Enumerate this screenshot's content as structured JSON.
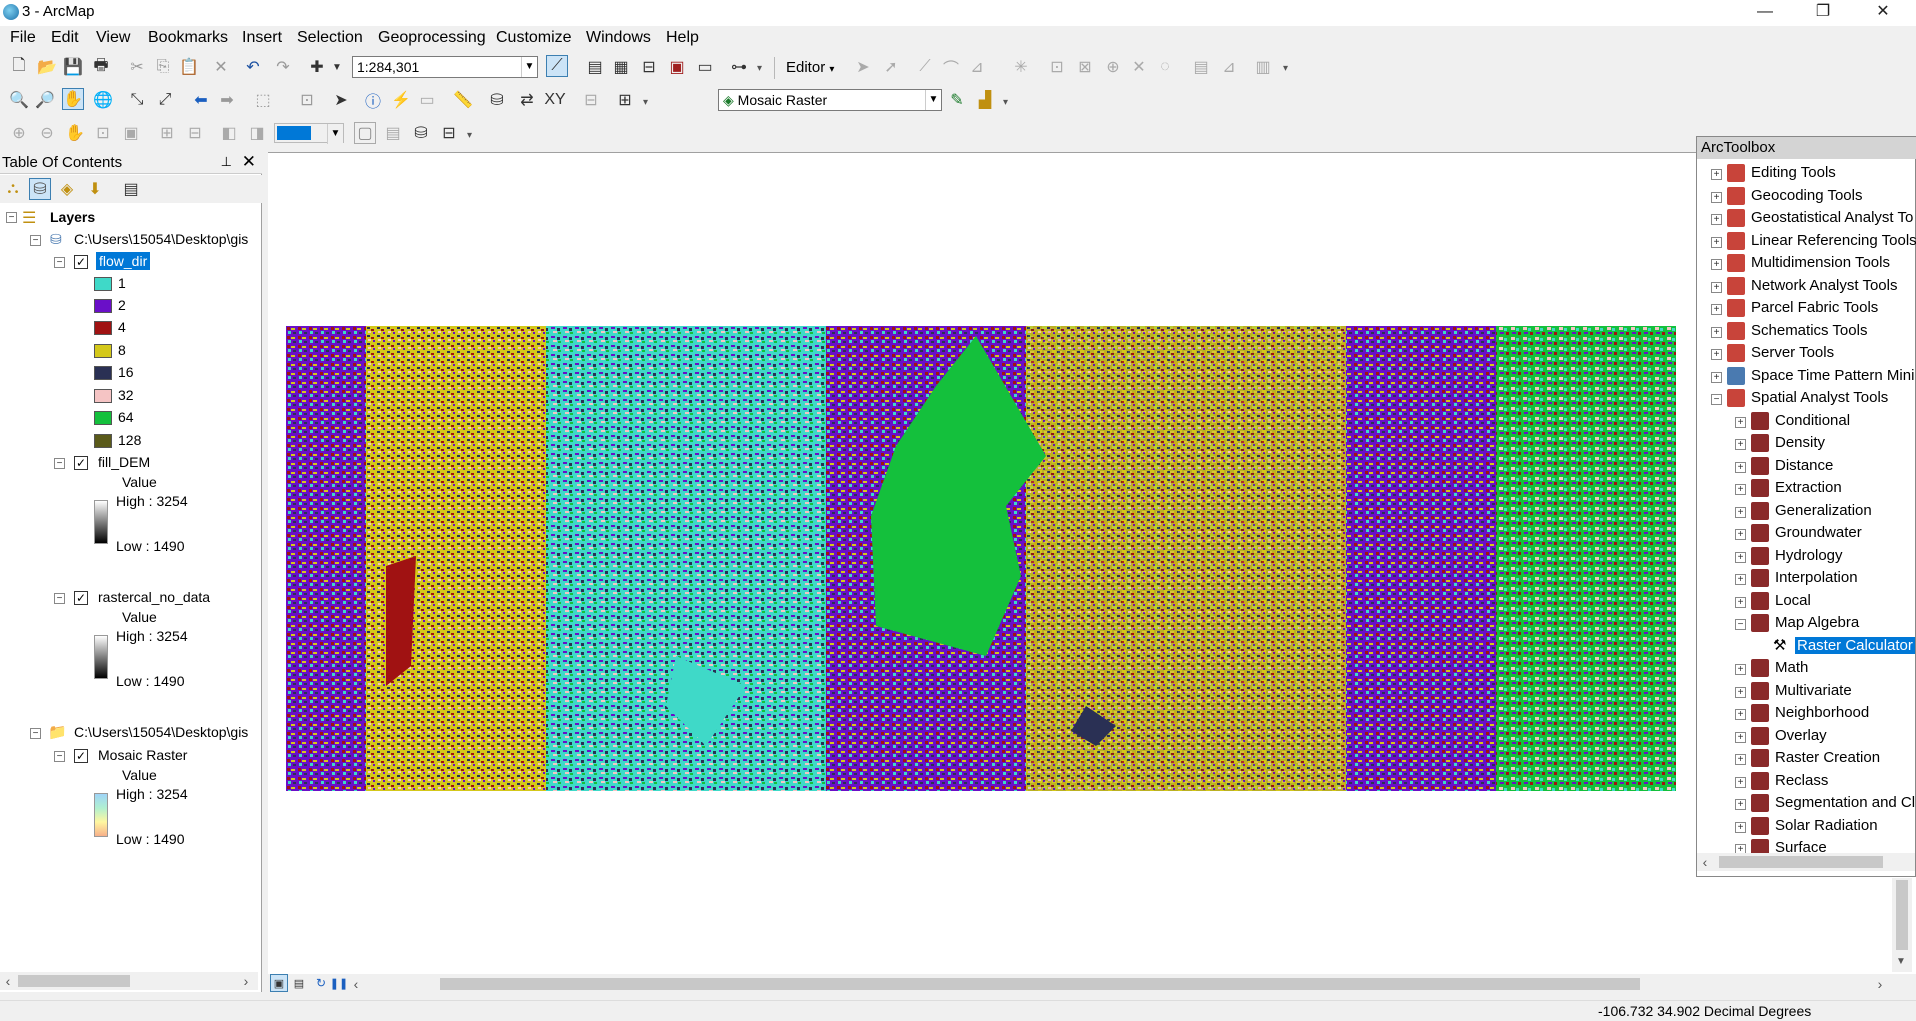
{
  "window": {
    "title": "3 - ArcMap"
  },
  "menu": [
    "File",
    "Edit",
    "View",
    "Bookmarks",
    "Insert",
    "Selection",
    "Geoprocessing",
    "Customize",
    "Windows",
    "Help"
  ],
  "toolbar": {
    "scale": "1:284,301",
    "editor_label": "Editor",
    "layer_combo": "Mosaic Raster"
  },
  "toc": {
    "title": "Table Of Contents",
    "layers_label": "Layers",
    "group1_path": "C:\\Users\\15054\\Desktop\\gis",
    "flow_dir": {
      "name": "flow_dir",
      "classes": [
        {
          "label": "1",
          "color": "#3fd9c8"
        },
        {
          "label": "2",
          "color": "#6a0fc8"
        },
        {
          "label": "4",
          "color": "#a01212"
        },
        {
          "label": "8",
          "color": "#d4c81a"
        },
        {
          "label": "16",
          "color": "#2a3054"
        },
        {
          "label": "32",
          "color": "#f5c4c4"
        },
        {
          "label": "64",
          "color": "#14c03c"
        },
        {
          "label": "128",
          "color": "#5a5a1a"
        }
      ]
    },
    "fill_dem": {
      "name": "fill_DEM",
      "value_label": "Value",
      "high": "High : 3254",
      "low": "Low : 1490"
    },
    "rastercal": {
      "name": "rastercal_no_data",
      "value_label": "Value",
      "high": "High : 3254",
      "low": "Low : 1490"
    },
    "group2_path": "C:\\Users\\15054\\Desktop\\gis",
    "mosaic": {
      "name": "Mosaic Raster",
      "value_label": "Value",
      "high": "High : 3254",
      "low": "Low : 1490"
    }
  },
  "arctoolbox": {
    "title": "ArcToolbox",
    "toolboxes": [
      "Editing Tools",
      "Geocoding Tools",
      "Geostatistical Analyst To",
      "Linear Referencing Tools",
      "Multidimension Tools",
      "Network Analyst Tools",
      "Parcel Fabric Tools",
      "Schematics Tools",
      "Server Tools",
      "Space Time Pattern Mini",
      "Spatial Analyst Tools"
    ],
    "toolsets": [
      "Conditional",
      "Density",
      "Distance",
      "Extraction",
      "Generalization",
      "Groundwater",
      "Hydrology",
      "Interpolation",
      "Local",
      "Map Algebra"
    ],
    "selected_tool": "Raster Calculator",
    "toolsets_after": [
      "Math",
      "Multivariate",
      "Neighborhood",
      "Overlay",
      "Raster Creation",
      "Reclass",
      "Segmentation and Cl",
      "Solar Radiation",
      "Surface"
    ]
  },
  "status": {
    "coords": "-106.732  34.902 Decimal Degrees"
  }
}
